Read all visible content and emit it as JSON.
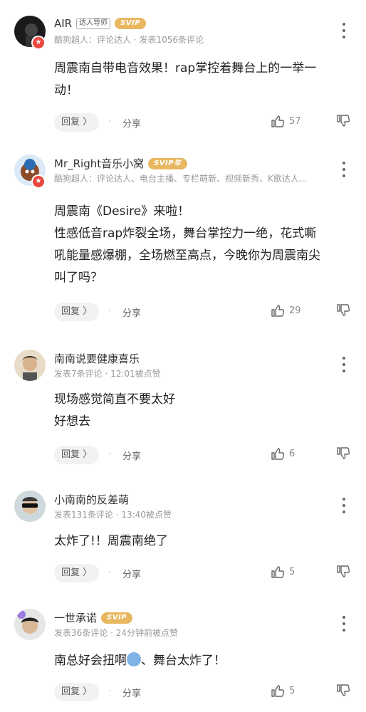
{
  "icons": {
    "more": "more-vertical-icon",
    "like": "thumb-up-icon",
    "dislike": "thumb-down-icon",
    "badge": "star-badge-icon"
  },
  "colors": {
    "svip": "#e8b860",
    "badge": "#e8473f"
  },
  "common": {
    "reply_label": "回复 〉",
    "share_label": "分享",
    "dot": "·"
  },
  "comments": [
    {
      "username": "AIR",
      "title_tag": "达人导师",
      "svip": "SVIP",
      "meta": "酷狗超人：评论达人 · 发表1056条评论",
      "lines": [
        "周震南自带电音效果！rap掌控着舞台上的一举一",
        "动！"
      ],
      "likes": "57"
    },
    {
      "username": "Mr_Right音乐小窝",
      "svip": "SVIP年",
      "meta": "酷狗超人：评论达人、电台主播、专栏萌新、视频新秀、K歌达人...",
      "lines": [
        "周震南《Desire》来啦！",
        "性感低音rap炸裂全场，舞台掌控力一绝，花式嘶",
        "吼能量感爆棚，全场燃至高点，今晚你为周震南尖",
        "叫了吗？"
      ],
      "likes": "29"
    },
    {
      "username": "南南说要健康喜乐",
      "meta": "发表7条评论 · 12:01被点赞",
      "lines": [
        "现场感觉简直不要太好",
        "好想去"
      ],
      "likes": "6"
    },
    {
      "username": "小南南的反差萌",
      "meta": "发表131条评论 · 13:40被点赞",
      "lines": [
        "太炸了!！周震南绝了"
      ],
      "likes": "5"
    },
    {
      "username": "一世承诺",
      "svip": "SVIP",
      "meta": "发表36条评论 · 24分钟前被点赞",
      "lines_parts": [
        "南总好会扭啊",
        "、舞台太炸了！"
      ],
      "emoji": "scared-face-emoji",
      "likes": "5"
    }
  ]
}
